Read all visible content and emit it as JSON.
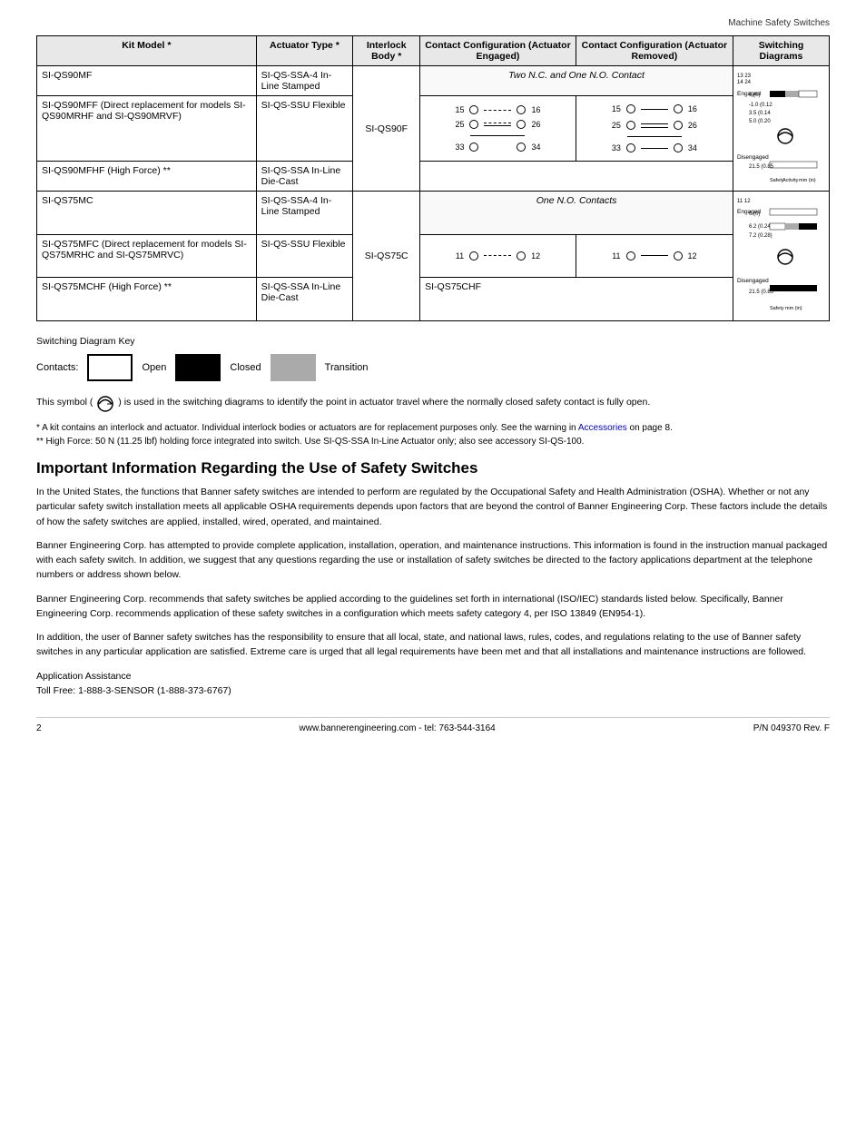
{
  "header": {
    "title": "Machine Safety Switches"
  },
  "table": {
    "columns": [
      "Kit Model *",
      "Actuator Type *",
      "Interlock Body *",
      "Contact Configuration (Actuator Engaged)",
      "Contact Configuration (Actuator Removed)",
      "Switching Diagrams"
    ],
    "rows": [
      {
        "kit_model": "SI-QS90MF",
        "actuator_type": "SI-QS-SSA-4 In-Line Stamped",
        "interlock_body": "SI-QS90F",
        "contact_engaged": "two_nc",
        "contact_removed": "two_nc",
        "switching_diagram": "sw90"
      },
      {
        "kit_model": "SI-QS90MFF (Direct replacement for models SI-QS90MRHF and SI-QS90MRVF)",
        "actuator_type": "SI-QS-SSU Flexible",
        "interlock_body": "SI-QS90F",
        "contact_engaged": "diagram90",
        "contact_removed": "diagram90r",
        "switching_diagram": "sw90"
      },
      {
        "kit_model": "SI-QS90MFHF (High Force) **",
        "actuator_type": "SI-QS-SSA In-Line Die-Cast",
        "interlock_body": "SI-QS90FSI-QS90F",
        "contact_engaged": "",
        "contact_removed": "",
        "switching_diagram": ""
      },
      {
        "kit_model": "SI-QS75MC",
        "actuator_type": "SI-QS-SSA-4 In-Line Stamped",
        "interlock_body": "SI-QS75C",
        "contact_engaged": "one_no",
        "contact_removed": "one_no",
        "switching_diagram": "sw75"
      },
      {
        "kit_model": "SI-QS75MFC (Direct replacement for models SI-QS75MRHC and SI-QS75MRVC)",
        "actuator_type": "SI-QS-SSU Flexible",
        "interlock_body": "SI-QS75C",
        "contact_engaged": "diagram75",
        "contact_removed": "diagram75r",
        "switching_diagram": "sw75"
      },
      {
        "kit_model": "SI-QS75MCHF (High Force) **",
        "actuator_type": "SI-QS-SSA In-Line Die-Cast",
        "interlock_body": "SI-QS75CHF",
        "contact_engaged": "",
        "contact_removed": "",
        "switching_diagram": ""
      }
    ]
  },
  "switching_key": {
    "title": "Switching Diagram Key",
    "contacts_label": "Contacts:",
    "open_label": "Open",
    "closed_label": "Closed",
    "transition_label": "Transition"
  },
  "symbol_note": "This symbol (",
  "symbol_note2": ") is used in the switching diagrams to identify the point in actuator travel where the normally closed safety contact is fully open.",
  "footnote1": "* A kit contains an interlock and actuator. Individual interlock bodies or actuators are for replacement purposes only. See the warning in",
  "footnote1_link": "Accessories",
  "footnote1_cont": "on page 8.",
  "footnote2": "** High Force: 50 N (11.25 lbf) holding force integrated into switch. Use SI-QS-SSA In-Line Actuator only; also see accessory SI-QS-100.",
  "important_title": "Important Information Regarding the Use of Safety Switches",
  "paragraphs": [
    "In the United States, the functions that Banner safety switches are intended to perform are regulated by the Occupational Safety and Health Administration (OSHA). Whether or not any particular safety switch installation meets all applicable OSHA requirements depends upon factors that are beyond the control of Banner Engineering Corp. These factors include the details of how the safety switches are applied, installed, wired, operated, and maintained.",
    "Banner Engineering Corp. has attempted to provide complete application, installation, operation, and maintenance instructions. This information is found in the instruction manual packaged with each safety switch. In addition, we suggest that any questions regarding the use or installation of safety switches be directed to the factory applications department at the telephone numbers or address shown below.",
    "Banner Engineering Corp. recommends that safety switches be applied according to the guidelines set forth in international (ISO/IEC) standards listed below. Specifically, Banner Engineering Corp. recommends application of these safety switches in a configuration which meets safety category 4, per ISO 13849 (EN954-1).",
    "In addition, the user of Banner safety switches has the responsibility to ensure that all local, state, and national laws, rules, codes, and regulations relating to the use of Banner safety switches in any particular application are satisfied. Extreme care is urged that all legal requirements have been met and that all installations and maintenance instructions are followed."
  ],
  "app_assist": {
    "label": "Application Assistance",
    "toll_free": "Toll Free: 1-888-3-SENSOR (1-888-373-6767)"
  },
  "footer": {
    "page_num": "2",
    "website": "www.bannerengineering.com - tel: 763-544-3164",
    "part_num": "P/N 049370 Rev. F"
  }
}
